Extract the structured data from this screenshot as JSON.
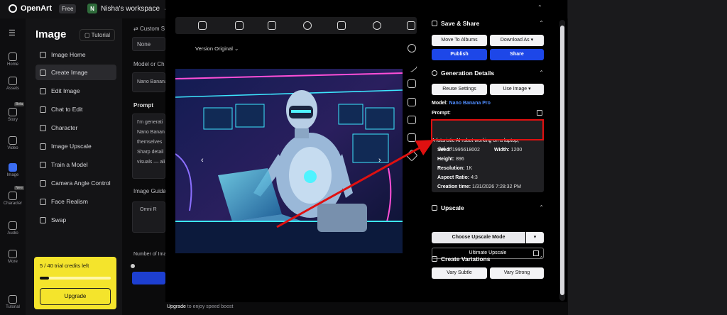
{
  "header": {
    "app_name": "OpenArt",
    "plan_badge": "Free",
    "workspace_initial": "N",
    "workspace_name": "Nisha's workspace"
  },
  "rail": [
    {
      "label": "Home",
      "icon": "home-icon"
    },
    {
      "label": "Assets",
      "icon": "folder-icon"
    },
    {
      "label": "Story",
      "icon": "story-icon",
      "badge": "Beta"
    },
    {
      "label": "Video",
      "icon": "video-icon"
    },
    {
      "label": "Image",
      "icon": "image-icon",
      "active": true
    },
    {
      "label": "Character",
      "icon": "character-icon",
      "badge": "New"
    },
    {
      "label": "Audio",
      "icon": "audio-icon"
    },
    {
      "label": "More",
      "icon": "grid-icon"
    },
    {
      "label": "Tutorial",
      "icon": "book-icon"
    }
  ],
  "menu": {
    "title": "Image",
    "tutorial_label": "Tutorial",
    "items": [
      {
        "label": "Image Home"
      },
      {
        "label": "Create Image",
        "active": true
      },
      {
        "label": "Edit Image"
      },
      {
        "label": "Chat to Edit"
      },
      {
        "label": "Character"
      },
      {
        "label": "Image Upscale"
      },
      {
        "label": "Train a Model"
      },
      {
        "label": "Camera Angle Control"
      },
      {
        "label": "Face Realism"
      },
      {
        "label": "Swap"
      }
    ],
    "credits": {
      "text": "5 / 40 trial credits left",
      "progress": 0.125,
      "upgrade_label": "Upgrade"
    }
  },
  "form": {
    "custom_label": "Custom S",
    "none_value": "None",
    "model_label": "Model or Ch",
    "model_value": "Nano Banana",
    "prompt_label": "Prompt",
    "prompt_lines": [
      "I'm generati",
      "Nano Banan",
      "themselves",
      "Sharp detail",
      "visuals — ali"
    ],
    "guidance_label": "Image Guida",
    "omni_value": "Omni R",
    "num_label": "Number of Ima",
    "footer_link": "Upgrade",
    "footer_text": " to enjoy speed boost"
  },
  "modal": {
    "version_label": "Version Original",
    "save_share": {
      "title": "Save & Share",
      "move_to_albums": "Move To Albums",
      "download_as": "Download As",
      "publish": "Publish",
      "share": "Share"
    },
    "details": {
      "title": "Generation Details",
      "reuse_settings": "Reuse Settings",
      "use_image": "Use Image",
      "model_key": "Model:",
      "model_value": "Nano Banana Pro",
      "prompt_key": "Prompt:",
      "prompt_line1": "A futuristic AI robot working on a laptop,",
      "prompt_line2": "ital art",
      "seed_key": "Seed:",
      "seed_value": "1995618002",
      "width_key": "Width:",
      "width_value": "1200",
      "height_key": "Height:",
      "height_value": "896",
      "resolution_key": "Resolution:",
      "resolution_value": "1K",
      "aspect_key": "Aspect Ratio:",
      "aspect_value": "4:3",
      "created_key": "Creation time:",
      "created_value": "1/31/2026 7:28:32 PM"
    },
    "upscale": {
      "title": "Upscale",
      "mode_label": "Choose Upscale Mode",
      "ultimate_label": "Ultimate Upscale"
    },
    "variations": {
      "title": "Create Variations",
      "subtle": "Vary Subtle",
      "strong": "Vary Strong"
    }
  },
  "colors": {
    "accent_blue": "#1d47e8",
    "highlight_red": "#e01010",
    "credits_yellow": "#f4e42c"
  }
}
